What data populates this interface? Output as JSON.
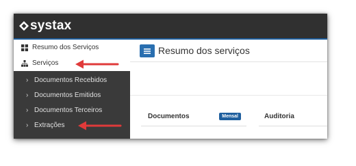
{
  "brand": {
    "name": "systax"
  },
  "sidebar": {
    "items": [
      {
        "label": "Resumo dos Serviços",
        "icon": "dashboard-icon"
      },
      {
        "label": "Serviços",
        "icon": "sitemap-icon"
      }
    ],
    "submenu": [
      {
        "label": "Documentos Recebidos"
      },
      {
        "label": "Documentos Emitidos"
      },
      {
        "label": "Documentos Terceiros"
      },
      {
        "label": "Extrações"
      }
    ]
  },
  "header": {
    "title": "Resumo dos serviços",
    "menu_icon": "hamburger-icon"
  },
  "cards": [
    {
      "title": "Documentos",
      "badge": "Mensal"
    },
    {
      "title": "Auditoria"
    }
  ],
  "colors": {
    "topbar": "#303030",
    "accent": "#1f5f9e",
    "submenu_bg": "#3a3a3a",
    "annotation_arrow": "#e03a3a"
  }
}
